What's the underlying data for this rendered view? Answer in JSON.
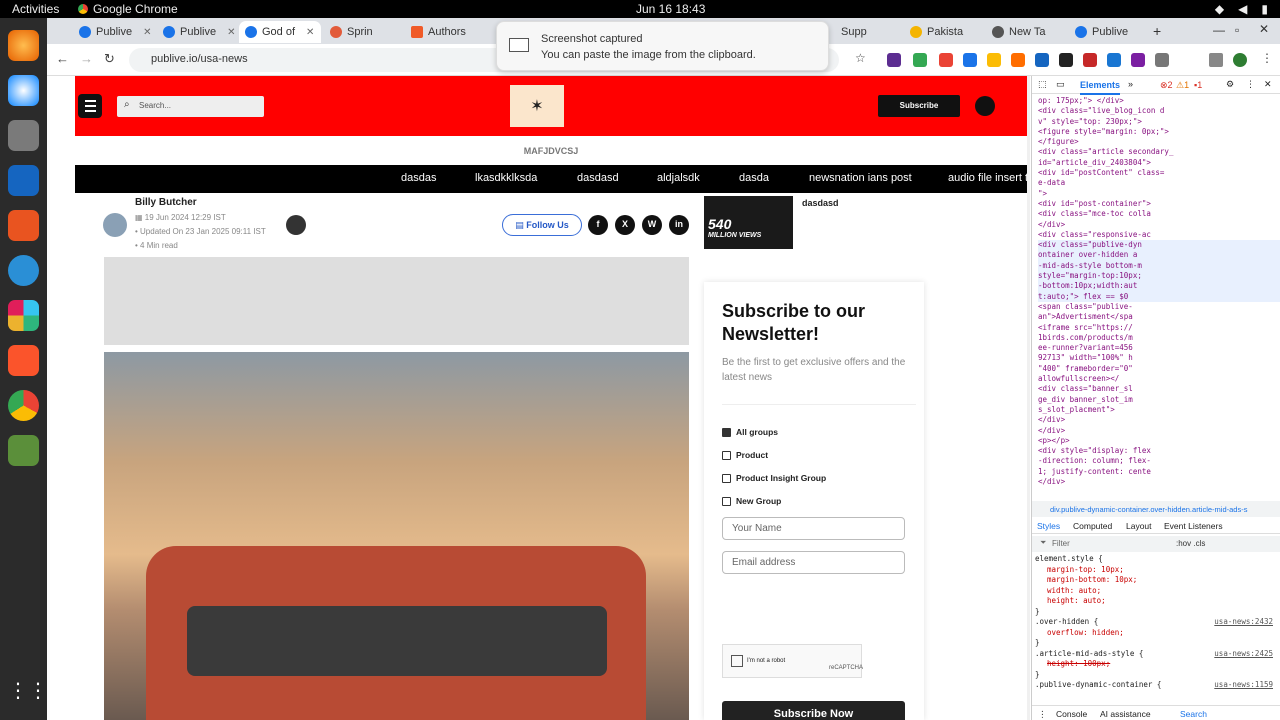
{
  "system": {
    "activities": "Activities",
    "app_name": "Google Chrome",
    "clock": "Jun 16  18:43"
  },
  "tabs": [
    {
      "label": "Publive"
    },
    {
      "label": "Publive"
    },
    {
      "label": "God of"
    },
    {
      "label": "Sprin"
    },
    {
      "label": "Authors"
    },
    {
      "label": "Supp"
    },
    {
      "label": "Pakista"
    },
    {
      "label": "New Ta"
    },
    {
      "label": "Publive"
    }
  ],
  "toast": {
    "title": "Screenshot captured",
    "message": "You can paste the image from the clipboard."
  },
  "address": {
    "url": "publive.io/usa-news"
  },
  "site": {
    "search_placeholder": "Search...",
    "subscribe_button": "Subscribe",
    "section_label": "MAFJDVCSJ",
    "categories": [
      "dasdas",
      "lkasdkklksda",
      "dasdasd",
      "aldjalsdk",
      "dasda",
      "newsnation ians post",
      "audio file insert te"
    ],
    "author": "Billy Butcher",
    "published": "19 Jun 2024 12:29 IST",
    "updated": "Updated On 23 Jan 2025 09:11 IST",
    "read_time": "4 Min read",
    "follow_label": "Follow Us",
    "social": [
      "f",
      "X",
      "W",
      "in"
    ],
    "thumb_overlay": "540",
    "thumb_overlay2": "MILLION VIEWS",
    "thumb_title": "dasdasd"
  },
  "newsletter": {
    "title": "Subscribe to our Newsletter!",
    "subtitle": "Be the first to get exclusive offers and the latest news",
    "groups": [
      {
        "label": "All groups",
        "checked": true
      },
      {
        "label": "Product",
        "checked": false
      },
      {
        "label": "Product Insight Group",
        "checked": false
      },
      {
        "label": "New Group",
        "checked": false
      }
    ],
    "name_placeholder": "Your Name",
    "email_placeholder": "Email address",
    "captcha_label": "I'm not a robot",
    "captcha_brand": "reCAPTCHA",
    "button": "Subscribe Now"
  },
  "devtools": {
    "tabs": {
      "elements": "Elements",
      "errors": "2",
      "warnings": "1",
      "issues": "1"
    },
    "tree": [
      "op: 175px;\"> </div>",
      "<div class=\"live_blog_icon d",
      "v\" style=\"top: 230px;\">",
      "<figure style=\"margin: 0px;\">",
      "</figure>",
      "<div class=\"article secondary_",
      "id=\"article_div_2403804\">",
      "<div id=\"postContent\" class=",
      "e-data",
      "",
      "\">",
      "<div id=\"post-container\">",
      "<div class=\"mce-toc colla",
      "</div>",
      "<div class=\"responsive-ac",
      "<div class=\"publive-dyn",
      "ontainer  over-hidden a",
      "-mid-ads-style bottom-m",
      "style=\"margin-top:10px;",
      "-bottom:10px;width:aut",
      "t:auto;\"> flex == $0",
      "<span class=\"publive-",
      "an\">Advertisment</spa",
      "<iframe src=\"https://",
      "1birds.com/products/m",
      "ee-runner?variant=456",
      "92713\" width=\"100%\" h",
      "\"400\" frameborder=\"0\"",
      "allowfullscreen></",
      "<div class=\"banner_sl",
      "ge_div banner_slot_im",
      "s_slot_placment\">",
      "</div>",
      "</div>",
      "<p></p>",
      "<div style=\"display: flex",
      "-direction: column; flex-",
      "1; justify-content: cente",
      "</div>"
    ],
    "breadcrumb": "div.publive-dynamic-container.over-hidden.article-mid-ads-s",
    "styles_tabs": [
      "Styles",
      "Computed",
      "Layout",
      "Event Listeners"
    ],
    "filter_placeholder": "Filter",
    "filter_flags": ":hov  .cls",
    "css_rules": [
      {
        "selector": "element.style {",
        "src": "",
        "props": [
          "margin-top: 10px;",
          "margin-bottom: 10px;",
          "width: auto;",
          "height: auto;"
        ]
      },
      {
        "selector": ".over-hidden {",
        "src": "usa-news:2432",
        "props": [
          "overflow: hidden;"
        ]
      },
      {
        "selector": ".article-mid-ads-style {",
        "src": "usa-news:2425",
        "props": [
          "height: 100px;"
        ]
      },
      {
        "selector": ".publive-dynamic-container {",
        "src": "usa-news:1159",
        "props": []
      }
    ],
    "drawer": [
      "Console",
      "AI assistance",
      "Search"
    ]
  }
}
